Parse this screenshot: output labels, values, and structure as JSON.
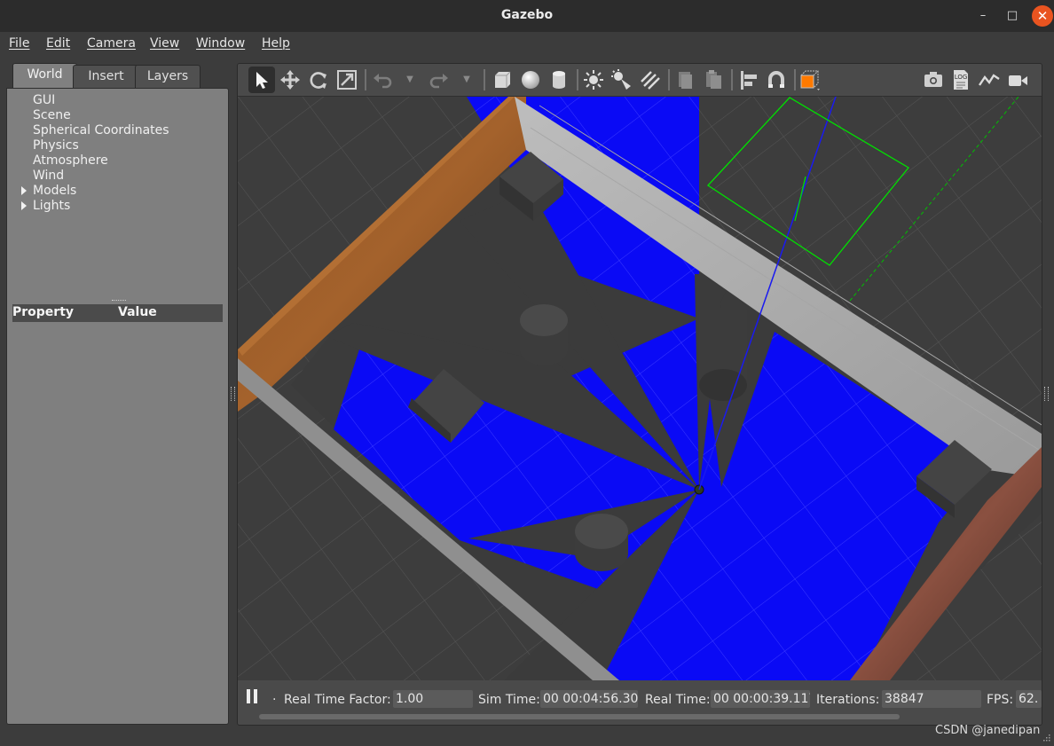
{
  "window": {
    "title": "Gazebo",
    "min_glyph": "–",
    "max_glyph": "□",
    "close_glyph": "✕"
  },
  "menu": [
    "File",
    "Edit",
    "Camera",
    "View",
    "Window",
    "Help"
  ],
  "left_panel": {
    "tabs": [
      "World",
      "Insert",
      "Layers"
    ],
    "active_tab": "World",
    "tree": [
      {
        "label": "GUI",
        "expandable": false
      },
      {
        "label": "Scene",
        "expandable": false
      },
      {
        "label": "Spherical Coordinates",
        "expandable": false
      },
      {
        "label": "Physics",
        "expandable": false
      },
      {
        "label": "Atmosphere",
        "expandable": false
      },
      {
        "label": "Wind",
        "expandable": false
      },
      {
        "label": "Models",
        "expandable": true
      },
      {
        "label": "Lights",
        "expandable": true
      }
    ],
    "property_header": {
      "property": "Property",
      "value": "Value"
    }
  },
  "toolbar": {
    "icons": [
      "select-arrow-icon",
      "translate-icon",
      "rotate-icon",
      "scale-icon",
      "undo-icon",
      "redo-icon",
      "box-icon",
      "sphere-icon",
      "cylinder-icon",
      "point-light-icon",
      "spot-light-icon",
      "directional-light-icon",
      "copy-icon",
      "paste-icon",
      "align-icon",
      "snap-icon",
      "view-angle-icon",
      "screenshot-icon",
      "log-icon",
      "plot-icon",
      "record-video-icon"
    ],
    "log_text": "LOG"
  },
  "status": {
    "real_time_factor_label": "Real Time Factor:",
    "real_time_factor": "1.00",
    "sim_time_label": "Sim Time:",
    "sim_time": "00 00:04:56.306",
    "real_time_label": "Real Time:",
    "real_time": "00 00:00:39.117",
    "iterations_label": "Iterations:",
    "iterations": "38847",
    "fps_label": "FPS:",
    "fps": "62.",
    "step_dot": "."
  },
  "watermark": "CSDN @janedipan",
  "colors": {
    "laser": "#0a0af5",
    "close_button": "#e95420",
    "camera_frustum": "#00e000",
    "axis_line": "#1a1af0",
    "brand_orange": "#ff7a00"
  }
}
